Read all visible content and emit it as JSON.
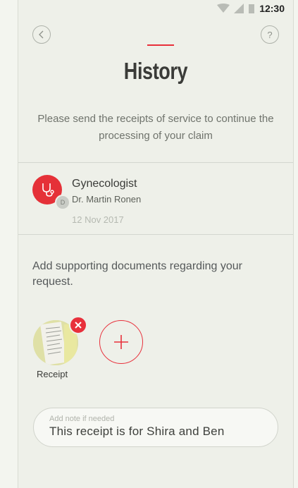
{
  "status_bar": {
    "time": "12:30"
  },
  "header": {
    "back_icon": "chevron-left-icon",
    "help_label": "?",
    "title": "History"
  },
  "instruction": "Please send the receipts of service to continue the processing of your claim",
  "claim": {
    "specialty": "Gynecologist",
    "avatar_initial": "D",
    "doctor": "Dr. Martin Ronen",
    "date": "12 Nov 2017",
    "icon": "stethoscope-icon"
  },
  "documents": {
    "prompt": "Add supporting documents regarding your request.",
    "items": [
      {
        "label": "Receipt"
      }
    ],
    "add_icon": "plus-icon",
    "remove_icon": "close-icon"
  },
  "note": {
    "label": "Add note if needed",
    "value": "This receipt is for Shira and Ben"
  },
  "colors": {
    "accent": "#e8303b",
    "background": "#eef0e9"
  }
}
